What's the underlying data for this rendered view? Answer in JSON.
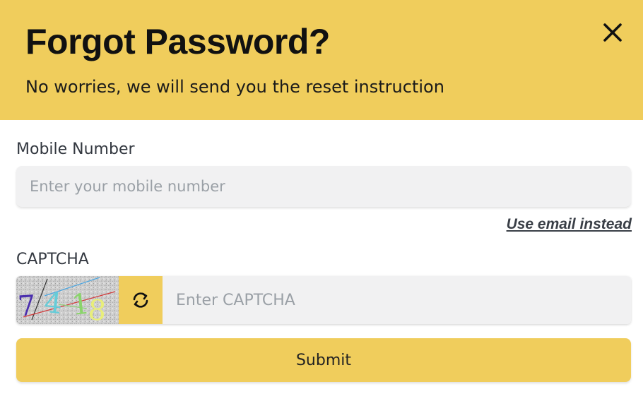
{
  "dialog": {
    "title": "Forgot Password?",
    "subtitle": "No worries, we will send you the reset instruction",
    "close_icon": "close-icon"
  },
  "mobile": {
    "label": "Mobile Number",
    "placeholder": "Enter your mobile number",
    "value": ""
  },
  "email_link": "Use email instead",
  "captcha": {
    "label": "CAPTCHA",
    "image_text": "7418",
    "placeholder": "Enter CAPTCHA",
    "value": "",
    "refresh_icon": "refresh-icon"
  },
  "submit_label": "Submit",
  "colors": {
    "accent": "#f0cd5c",
    "input_bg": "#f1f1f2",
    "placeholder": "#9aa0a6"
  }
}
